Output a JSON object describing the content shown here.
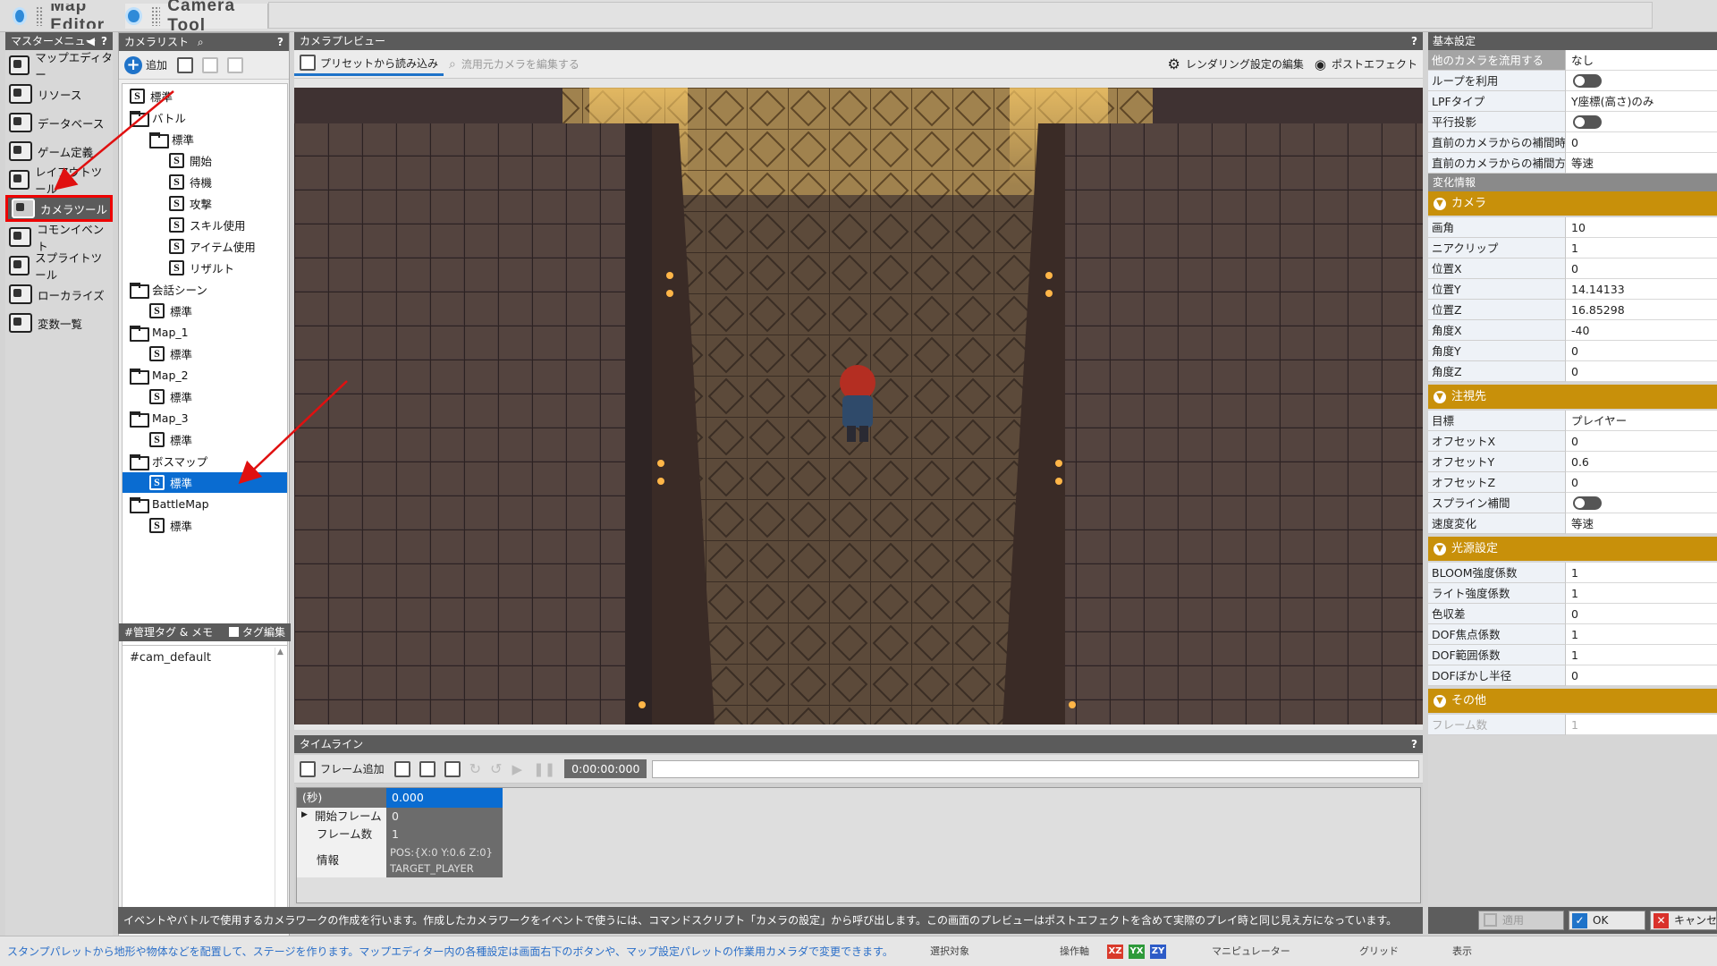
{
  "window_tabs": [
    {
      "label": "Map Editor"
    },
    {
      "label": "Camera Tool"
    }
  ],
  "master_menu": {
    "title": "マスターメニュー",
    "help": "?",
    "items": [
      {
        "label": "マップエディター",
        "icon": "map-editor-icon"
      },
      {
        "label": "リソース",
        "icon": "resource-icon"
      },
      {
        "label": "データベース",
        "icon": "database-icon"
      },
      {
        "label": "ゲーム定義",
        "icon": "game-definition-icon"
      },
      {
        "label": "レイアウトツール",
        "icon": "layout-tool-icon"
      },
      {
        "label": "カメラツール",
        "icon": "camera-tool-icon",
        "selected": true
      },
      {
        "label": "コモンイベント",
        "icon": "common-event-icon"
      },
      {
        "label": "スプライトツール",
        "icon": "sprite-tool-icon"
      },
      {
        "label": "ローカライズ",
        "icon": "localize-icon"
      },
      {
        "label": "変数一覧",
        "icon": "variable-list-icon"
      }
    ]
  },
  "camera_list": {
    "title": "カメラリスト",
    "help": "?",
    "add_label": "追加",
    "tree": [
      {
        "type": "script",
        "label": "標準",
        "depth": 0
      },
      {
        "type": "folder",
        "label": "バトル",
        "depth": 0
      },
      {
        "type": "folder",
        "label": "標準",
        "depth": 1
      },
      {
        "type": "script",
        "label": "開始",
        "depth": 2
      },
      {
        "type": "script",
        "label": "待機",
        "depth": 2
      },
      {
        "type": "script",
        "label": "攻撃",
        "depth": 2
      },
      {
        "type": "script",
        "label": "スキル使用",
        "depth": 2
      },
      {
        "type": "script",
        "label": "アイテム使用",
        "depth": 2
      },
      {
        "type": "script",
        "label": "リザルト",
        "depth": 2
      },
      {
        "type": "folder",
        "label": "会話シーン",
        "depth": 0
      },
      {
        "type": "script",
        "label": "標準",
        "depth": 1
      },
      {
        "type": "folder",
        "label": "Map_1",
        "depth": 0
      },
      {
        "type": "script",
        "label": "標準",
        "depth": 1
      },
      {
        "type": "folder",
        "label": "Map_2",
        "depth": 0
      },
      {
        "type": "script",
        "label": "標準",
        "depth": 1
      },
      {
        "type": "folder",
        "label": "Map_3",
        "depth": 0
      },
      {
        "type": "script",
        "label": "標準",
        "depth": 1
      },
      {
        "type": "folder",
        "label": "ボスマップ",
        "depth": 0
      },
      {
        "type": "script",
        "label": "標準",
        "depth": 1,
        "selected": true
      },
      {
        "type": "folder",
        "label": "BattleMap",
        "depth": 0
      },
      {
        "type": "script",
        "label": "標準",
        "depth": 1
      }
    ],
    "tags_title": "#管理タグ & メモ",
    "tag_edit_label": "タグ編集",
    "tag_text": "#cam_default"
  },
  "preview": {
    "title": "カメラプレビュー",
    "help": "?",
    "load_preset_label": "プリセットから読み込み",
    "edit_source_label": "流用元カメラを編集する",
    "render_settings_label": "レンダリング設定の編集",
    "post_effect_label": "ポストエフェクト"
  },
  "timeline": {
    "title": "タイムライン",
    "help": "?",
    "add_frame_label": "フレーム追加",
    "time_display": "0:00:00:000",
    "rows": [
      {
        "key": "(秒)",
        "value": "0.000"
      },
      {
        "key": "開始フレーム",
        "value": "0"
      },
      {
        "key": "フレーム数",
        "value": "1"
      },
      {
        "key": "情報",
        "value": "POS:{X:0 Y:0.6 Z:0}",
        "value2": "TARGET_PLAYER"
      }
    ]
  },
  "properties": {
    "basic_title": "基本設定",
    "basic": [
      {
        "key": "他のカメラを流用する",
        "value": "なし"
      },
      {
        "key": "ループを利用",
        "toggle": true
      },
      {
        "key": "LPFタイプ",
        "value": "Y座標(高さ)のみ"
      },
      {
        "key": "平行投影",
        "toggle": true
      },
      {
        "key": "直前のカメラからの補間時間(秒)",
        "value": "0"
      },
      {
        "key": "直前のカメラからの補間方法",
        "value": "等速"
      }
    ],
    "change_title": "変化情報",
    "sections": [
      {
        "title": "カメラ",
        "rows": [
          {
            "key": "画角",
            "value": "10"
          },
          {
            "key": "ニアクリップ",
            "value": "1"
          },
          {
            "key": "位置X",
            "value": "0"
          },
          {
            "key": "位置Y",
            "value": "14.14133"
          },
          {
            "key": "位置Z",
            "value": "16.85298"
          },
          {
            "key": "角度X",
            "value": "-40"
          },
          {
            "key": "角度Y",
            "value": "0"
          },
          {
            "key": "角度Z",
            "value": "0"
          }
        ]
      },
      {
        "title": "注視先",
        "rows": [
          {
            "key": "目標",
            "value": "プレイヤー"
          },
          {
            "key": "オフセットX",
            "value": "0"
          },
          {
            "key": "オフセットY",
            "value": "0.6"
          },
          {
            "key": "オフセットZ",
            "value": "0"
          },
          {
            "key": "スプライン補間",
            "toggle": true
          },
          {
            "key": "速度変化",
            "value": "等速"
          }
        ]
      },
      {
        "title": "光源設定",
        "rows": [
          {
            "key": "BLOOM強度係数",
            "value": "1"
          },
          {
            "key": "ライト強度係数",
            "value": "1"
          },
          {
            "key": "色収差",
            "value": "0"
          },
          {
            "key": "DOF焦点係数",
            "value": "1"
          },
          {
            "key": "DOF範囲係数",
            "value": "1"
          },
          {
            "key": "DOFぼかし半径",
            "value": "0"
          }
        ]
      },
      {
        "title": "その他",
        "rows": [
          {
            "key": "フレーム数",
            "value": "1",
            "disabled": true
          }
        ]
      }
    ]
  },
  "description": "イベントやバトルで使用するカメラワークの作成を行います。作成したカメラワークをイベントで使うには、コマンドスクリプト「カメラの設定」から呼び出します。この画面のプレビューはポストエフェクトを含めて実際のプレイ時と同じ見え方になっています。",
  "dialog_buttons": {
    "apply": "適用",
    "ok": "OK",
    "cancel": "キャンセル"
  },
  "bottom_bar": {
    "hint": "スタンプパレットから地形や物体などを配置して、ステージを作ります。マップエディター内の各種設定は画面右下のボタンや、マップ設定パレットの作業用カメラダで変更できます。",
    "select_target": "選択対象",
    "operation_axis": "操作軸",
    "manipulator": "マニピュレーター",
    "grid": "グリッド",
    "display": "表示"
  },
  "colors": {
    "accent": "#0a6cd1",
    "section": "#c8900a",
    "annotation": "#e01010"
  }
}
